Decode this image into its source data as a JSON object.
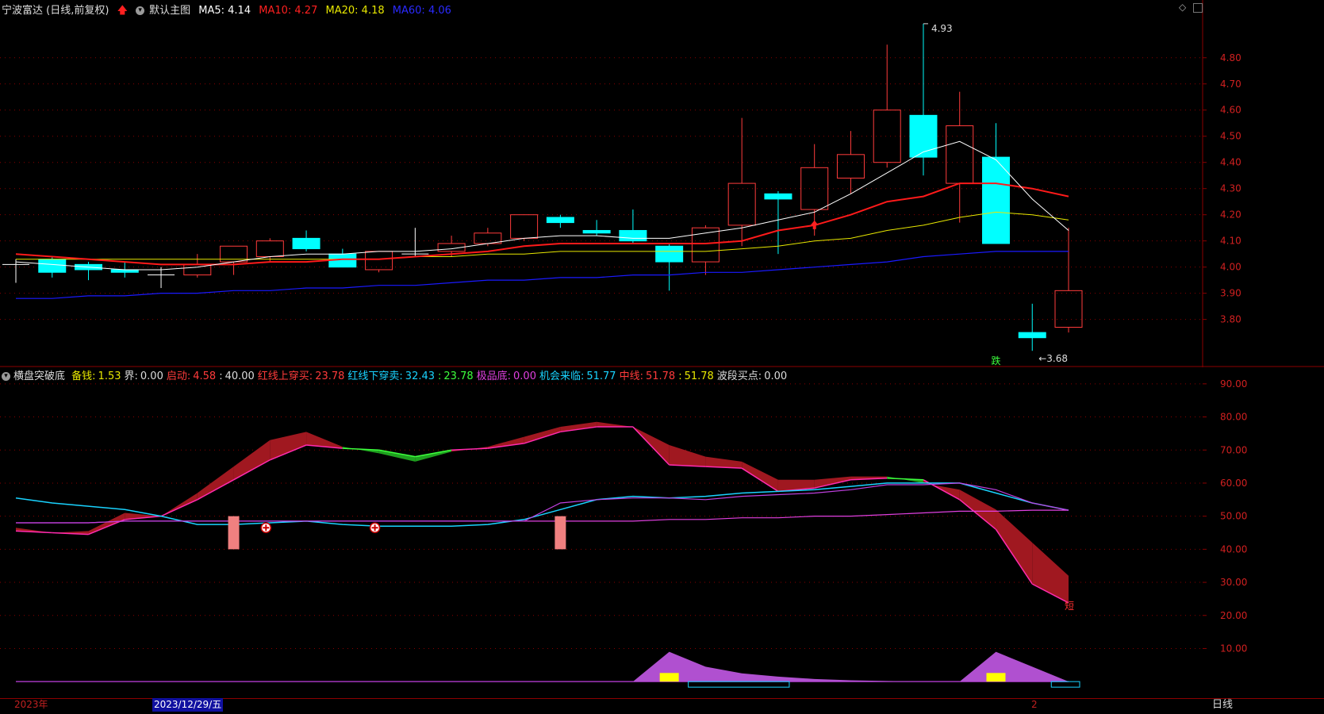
{
  "main_header": {
    "stock_title": "宁波富达 (日线,前复权)",
    "template_label": "默认主图",
    "ma5_label": "MA5:",
    "ma5_value": "4.14",
    "ma10_label": "MA10:",
    "ma10_value": "4.27",
    "ma20_label": "MA20:",
    "ma20_value": "4.18",
    "ma60_label": "MA60:",
    "ma60_value": "4.06"
  },
  "indicator_header": {
    "name": "横盘突破底",
    "items": [
      {
        "label": "备钱:",
        "value": "1.53",
        "color": "#e8e800"
      },
      {
        "label": "界:",
        "value": "0.00",
        "color": "#dddddd"
      },
      {
        "label": "启动:",
        "value": "4.58",
        "color": "#ff3b3b"
      },
      {
        "label": ":",
        "value": "40.00",
        "color": "#dddddd"
      },
      {
        "label": "红线上穿买:",
        "value": "23.78",
        "color": "#ff3b3b"
      },
      {
        "label": "红线下穿卖:",
        "value": "32.43",
        "color": "#19d3ff"
      },
      {
        "label": ":",
        "value": "23.78",
        "color": "#3dff3d"
      },
      {
        "label": "极品底:",
        "value": "0.00",
        "color": "#e040e0"
      },
      {
        "label": "机会来临:",
        "value": "51.77",
        "color": "#19d3ff"
      },
      {
        "label": "中线:",
        "value": "51.78",
        "color": "#ff3b3b"
      },
      {
        "label": ":",
        "value": "51.78",
        "color": "#e8e800"
      },
      {
        "label": "波段买点:",
        "value": "0.00",
        "color": "#dddddd"
      }
    ]
  },
  "annotations": {
    "high_label": "4.93",
    "low_label": "3.68",
    "die_label": "跌",
    "duan_label": "短"
  },
  "bottom_bar": {
    "year_label": "2023年",
    "cursor_date": "2023/12/29/五",
    "month_label": "2",
    "period_label": "日线"
  },
  "colors": {
    "up": "#ff3b3b",
    "down": "#00ffff",
    "ma5": "#ffffff",
    "ma10": "#ff1a1a",
    "ma20": "#e8e800",
    "ma60": "#1a1aff",
    "grid": "#8b0000",
    "red_band": "#a01820",
    "green_band": "#1fa01f",
    "pink_line": "#ff2bb0",
    "cyan_line": "#19d3ff",
    "magenta_line": "#e040e0",
    "purple_fill": "#b050d0"
  },
  "chart_data": [
    {
      "type": "candlestick",
      "title": "宁波富达 (日线,前复权)",
      "ylim": [
        3.62,
        4.96
      ],
      "y_ticks": [
        "4.80",
        "4.70",
        "4.60",
        "4.50",
        "4.40",
        "4.30",
        "4.20",
        "4.10",
        "4.00",
        "3.90",
        "3.80"
      ],
      "candles": [
        {
          "o": 4.01,
          "h": 4.03,
          "l": 3.94,
          "c": 4.01
        },
        {
          "o": 4.03,
          "h": 4.04,
          "l": 3.96,
          "c": 3.98
        },
        {
          "o": 4.01,
          "h": 4.02,
          "l": 3.95,
          "c": 3.99
        },
        {
          "o": 3.99,
          "h": 4.02,
          "l": 3.96,
          "c": 3.98
        },
        {
          "o": 3.97,
          "h": 4.0,
          "l": 3.92,
          "c": 3.97
        },
        {
          "o": 3.97,
          "h": 4.05,
          "l": 3.96,
          "c": 4.01
        },
        {
          "o": 4.02,
          "h": 4.08,
          "l": 3.97,
          "c": 4.08
        },
        {
          "o": 4.04,
          "h": 4.11,
          "l": 4.02,
          "c": 4.1
        },
        {
          "o": 4.11,
          "h": 4.14,
          "l": 4.06,
          "c": 4.07
        },
        {
          "o": 4.05,
          "h": 4.07,
          "l": 4.0,
          "c": 4.0
        },
        {
          "o": 3.99,
          "h": 4.06,
          "l": 3.98,
          "c": 4.06
        },
        {
          "o": 4.05,
          "h": 4.15,
          "l": 4.04,
          "c": 4.05
        },
        {
          "o": 4.06,
          "h": 4.12,
          "l": 4.04,
          "c": 4.09
        },
        {
          "o": 4.09,
          "h": 4.15,
          "l": 4.08,
          "c": 4.13
        },
        {
          "o": 4.11,
          "h": 4.2,
          "l": 4.1,
          "c": 4.2
        },
        {
          "o": 4.19,
          "h": 4.2,
          "l": 4.15,
          "c": 4.17
        },
        {
          "o": 4.14,
          "h": 4.18,
          "l": 4.12,
          "c": 4.13
        },
        {
          "o": 4.14,
          "h": 4.22,
          "l": 4.09,
          "c": 4.1
        },
        {
          "o": 4.08,
          "h": 4.09,
          "l": 3.91,
          "c": 4.02
        },
        {
          "o": 4.02,
          "h": 4.16,
          "l": 3.97,
          "c": 4.15
        },
        {
          "o": 4.16,
          "h": 4.57,
          "l": 4.08,
          "c": 4.32
        },
        {
          "o": 4.28,
          "h": 4.29,
          "l": 4.05,
          "c": 4.26
        },
        {
          "o": 4.22,
          "h": 4.47,
          "l": 4.12,
          "c": 4.38
        },
        {
          "o": 4.34,
          "h": 4.52,
          "l": 4.28,
          "c": 4.43
        },
        {
          "o": 4.4,
          "h": 4.85,
          "l": 4.38,
          "c": 4.6
        },
        {
          "o": 4.58,
          "h": 4.93,
          "l": 4.35,
          "c": 4.42
        },
        {
          "o": 4.32,
          "h": 4.67,
          "l": 4.17,
          "c": 4.54
        },
        {
          "o": 4.42,
          "h": 4.55,
          "l": 4.09,
          "c": 4.09
        },
        {
          "o": 3.75,
          "h": 3.86,
          "l": 3.68,
          "c": 3.73
        },
        {
          "o": 3.77,
          "h": 4.15,
          "l": 3.75,
          "c": 3.91
        }
      ],
      "ma5": [
        4.02,
        4.01,
        4.0,
        3.99,
        3.99,
        4.0,
        4.02,
        4.04,
        4.05,
        4.05,
        4.06,
        4.06,
        4.07,
        4.09,
        4.11,
        4.12,
        4.12,
        4.11,
        4.11,
        4.13,
        4.15,
        4.18,
        4.21,
        4.28,
        4.36,
        4.44,
        4.48,
        4.41,
        4.26,
        4.14
      ],
      "ma10": [
        4.05,
        4.04,
        4.03,
        4.02,
        4.01,
        4.01,
        4.01,
        4.02,
        4.02,
        4.03,
        4.03,
        4.04,
        4.05,
        4.06,
        4.08,
        4.09,
        4.09,
        4.09,
        4.09,
        4.09,
        4.1,
        4.14,
        4.16,
        4.2,
        4.25,
        4.27,
        4.32,
        4.32,
        4.3,
        4.27
      ],
      "ma20": [
        4.03,
        4.03,
        4.03,
        4.03,
        4.03,
        4.03,
        4.03,
        4.03,
        4.03,
        4.03,
        4.03,
        4.04,
        4.04,
        4.05,
        4.05,
        4.06,
        4.06,
        4.06,
        4.06,
        4.06,
        4.07,
        4.08,
        4.1,
        4.11,
        4.14,
        4.16,
        4.19,
        4.21,
        4.2,
        4.18
      ],
      "ma60": [
        3.88,
        3.88,
        3.89,
        3.89,
        3.9,
        3.9,
        3.91,
        3.91,
        3.92,
        3.92,
        3.93,
        3.93,
        3.94,
        3.95,
        3.95,
        3.96,
        3.96,
        3.97,
        3.97,
        3.98,
        3.98,
        3.99,
        4.0,
        4.01,
        4.02,
        4.04,
        4.05,
        4.06,
        4.06,
        4.06
      ],
      "markers": [
        {
          "index": 22,
          "type": "red-up-arrow"
        }
      ]
    },
    {
      "type": "area",
      "title": "横盘突破底",
      "ylim": [
        -5,
        95
      ],
      "y_ticks": [
        "90.00",
        "80.00",
        "70.00",
        "60.00",
        "50.00",
        "40.00",
        "30.00",
        "20.00",
        "10.00"
      ],
      "line_a": [
        46.5,
        45,
        45.5,
        51,
        50,
        57,
        65,
        73,
        75.5,
        71,
        69,
        66.5,
        69.5,
        71,
        74,
        77,
        78.5,
        77,
        71.5,
        68,
        66.5,
        61,
        61,
        62,
        62,
        60,
        58,
        52,
        42,
        32
      ],
      "line_b": [
        45.5,
        45,
        44.5,
        49,
        50,
        55,
        61,
        67,
        71.5,
        70.5,
        70,
        68,
        70,
        70.5,
        72,
        75.5,
        77,
        77,
        65.5,
        65,
        64.5,
        57.5,
        58.5,
        61,
        61.5,
        61,
        55,
        46,
        29.5,
        23.8
      ],
      "cyan_line": [
        55.5,
        54,
        53,
        52,
        50,
        47.5,
        47.5,
        48,
        48.5,
        47.5,
        47,
        47,
        47,
        47.5,
        49,
        52,
        55,
        56,
        55.5,
        56,
        57,
        57.5,
        58,
        59,
        60,
        60,
        60,
        57,
        54,
        51.8
      ],
      "pink_line": [
        48,
        48.5,
        48.5,
        49,
        49,
        49,
        48.5,
        48.5,
        48.5,
        48.5,
        48.5,
        48.5,
        48.5,
        48.5,
        48.5,
        54,
        55,
        55.5,
        55.5,
        55,
        56,
        56.5,
        57,
        58,
        59.5,
        59.5,
        60,
        58,
        54,
        51.8
      ],
      "magenta_line": [
        48,
        48,
        48,
        48.5,
        48.5,
        48.5,
        48.5,
        48.5,
        48.5,
        48.5,
        48.5,
        48.5,
        48.5,
        48.5,
        48.5,
        48.5,
        48.5,
        48.5,
        49,
        49,
        49.5,
        49.5,
        50,
        50,
        50.5,
        51,
        51.5,
        51.5,
        51.8,
        51.8
      ],
      "salmon_bars": [
        6,
        15
      ],
      "plus_markers": [
        7,
        10
      ],
      "purple_bump": [
        0,
        0,
        0,
        0,
        0,
        0,
        0,
        0,
        0,
        0,
        0,
        0,
        0,
        0,
        0,
        0,
        0,
        0,
        9,
        4.5,
        2.5,
        1.5,
        0.8,
        0.4,
        0.2,
        0,
        0,
        9,
        4.5,
        0
      ],
      "yellow_boxes": [
        18,
        27
      ]
    }
  ]
}
